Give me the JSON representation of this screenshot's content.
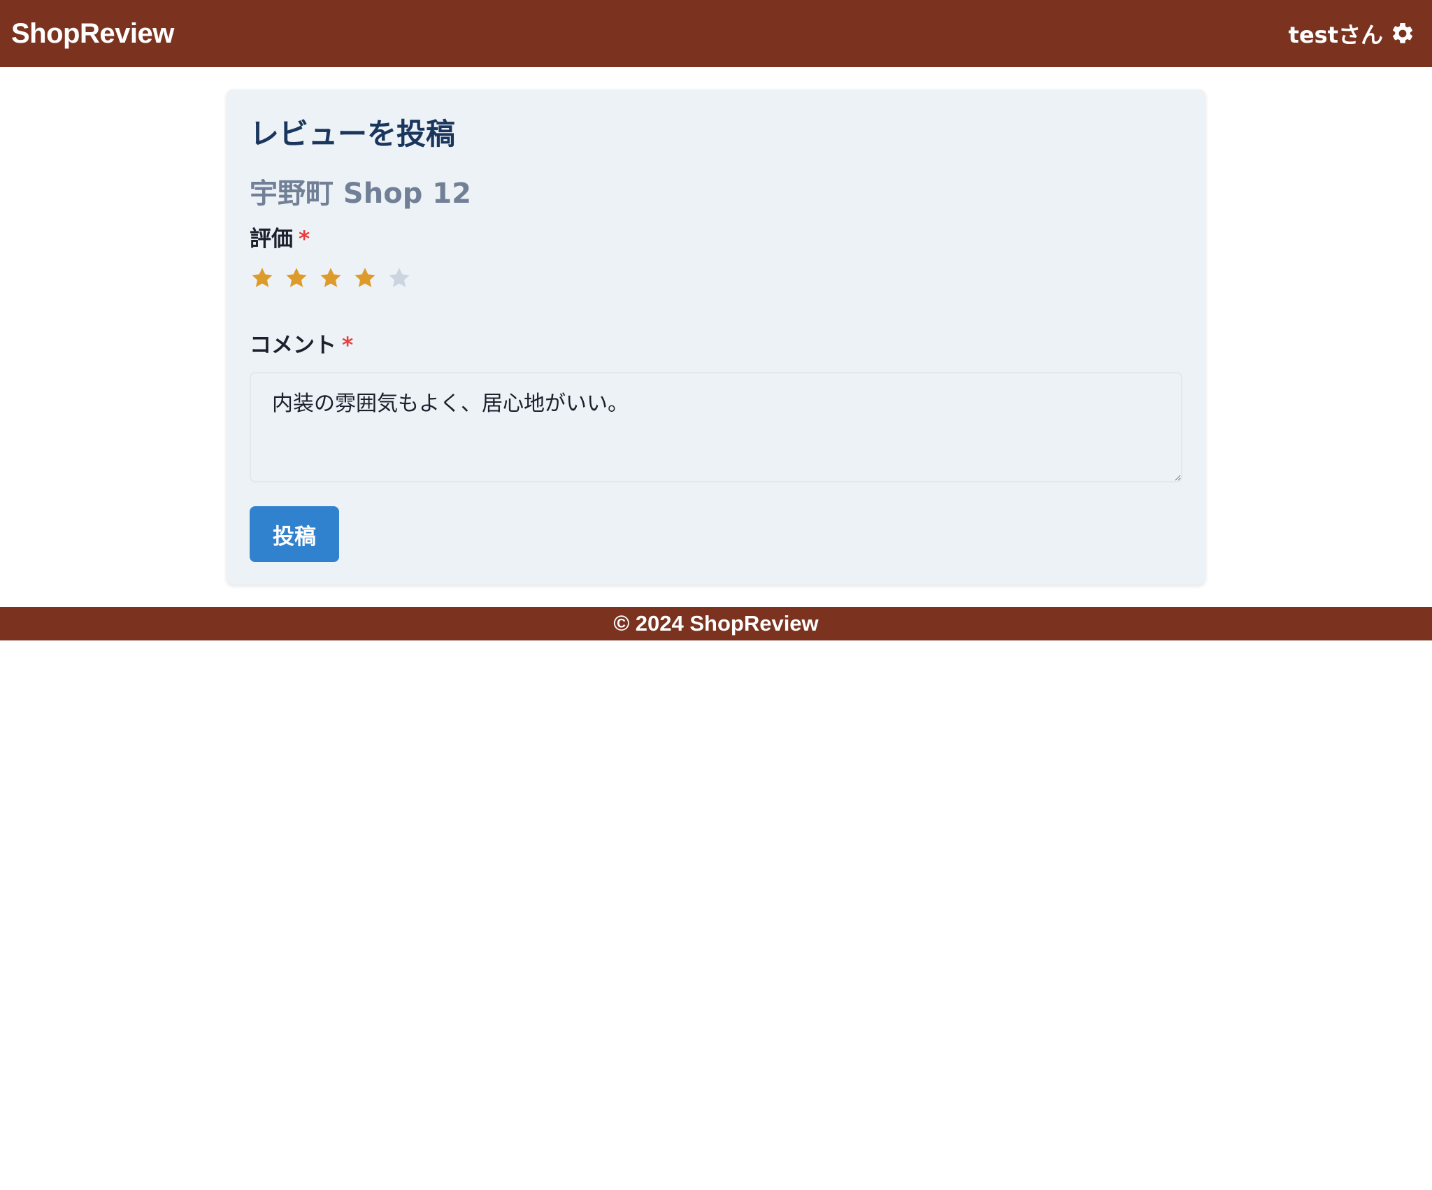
{
  "header": {
    "brand": "ShopReview",
    "user_label": "testさん",
    "settings_icon": "gear-icon",
    "bg_color": "#7b3320"
  },
  "form": {
    "title": "レビューを投稿",
    "shop_name": "宇野町 Shop 12",
    "rating_label": "評価",
    "required_mark": "*",
    "rating": {
      "value": 4,
      "max": 5,
      "filled_color": "#dd9b2c",
      "empty_color": "#cbd5e0"
    },
    "comment_label": "コメント",
    "comment_value": "内装の雰囲気もよく、居心地がいい。",
    "submit_label": "投稿",
    "submit_color": "#3182ce"
  },
  "footer": {
    "text": "© 2024 ShopReview"
  }
}
